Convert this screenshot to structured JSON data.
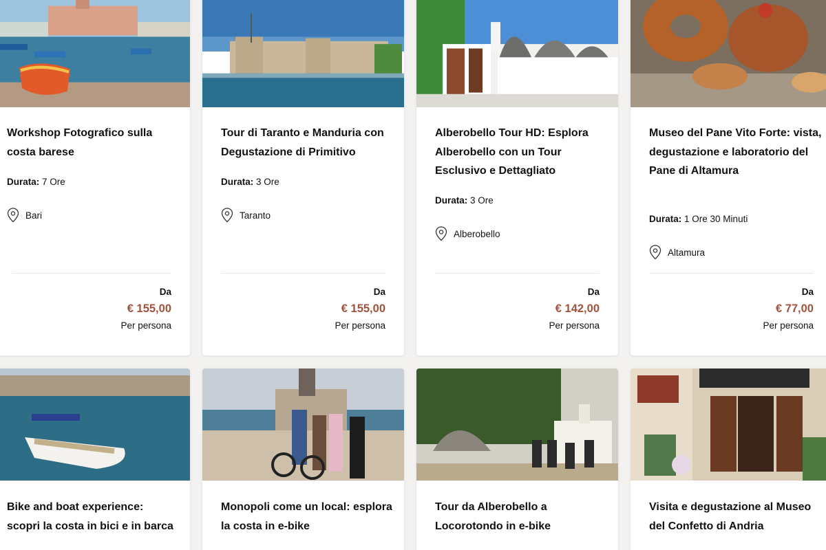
{
  "labels": {
    "duration": "Durata:",
    "price_from": "Da",
    "per_person": "Per persona"
  },
  "colors": {
    "price": "#a0523c",
    "background": "#f3f2f0"
  },
  "cards": [
    {
      "title": "Workshop Fotografico sulla costa barese",
      "duration": "7 Ore",
      "location": "Bari",
      "price": "€ 155,00"
    },
    {
      "title": "Tour di Taranto e Manduria con Degustazione di Primitivo",
      "duration": "3 Ore",
      "location": "Taranto",
      "price": "€ 155,00"
    },
    {
      "title": "Alberobello Tour HD: Esplora Alberobello con un Tour Esclusivo e Dettagliato",
      "duration": "3 Ore",
      "location": "Alberobello",
      "price": "€ 142,00"
    },
    {
      "title": "Museo del Pane Vito Forte: vista, degustazione e laboratorio del Pane di Altamura",
      "duration": "1 Ore 30 Minuti",
      "location": "Altamura",
      "price": "€ 77,00"
    },
    {
      "title": "Bike and boat experience: scopri la costa in bici e in barca"
    },
    {
      "title": "Monopoli come un local: esplora la costa in e-bike"
    },
    {
      "title": "Tour da Alberobello a Locorotondo in e-bike"
    },
    {
      "title": "Visita e degustazione al Museo del Confetto di Andria"
    }
  ]
}
